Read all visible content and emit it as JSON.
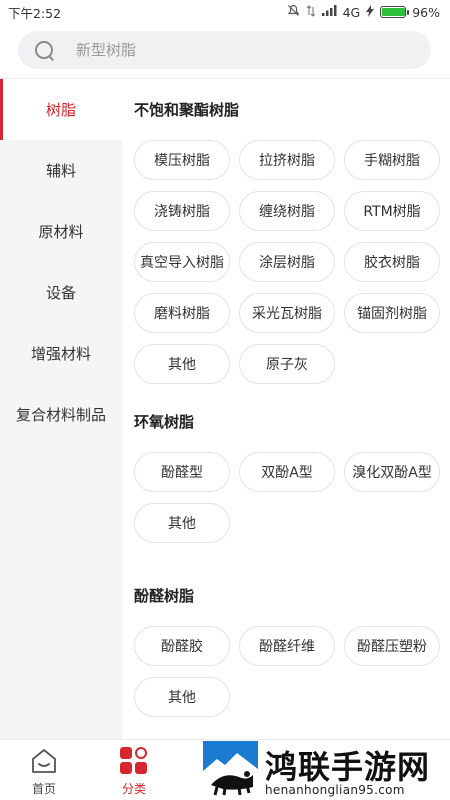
{
  "status_bar": {
    "time": "下午2:52",
    "network": "4G",
    "battery_text": "96%",
    "battery_level": 0.96,
    "battery_color": "#2bbf3a"
  },
  "search": {
    "placeholder": "新型树脂",
    "value": ""
  },
  "sidebar": {
    "items": [
      {
        "label": "树脂",
        "active": true
      },
      {
        "label": "辅料",
        "active": false
      },
      {
        "label": "原材料",
        "active": false
      },
      {
        "label": "设备",
        "active": false
      },
      {
        "label": "增强材料",
        "active": false
      },
      {
        "label": "复合材料制品",
        "active": false
      }
    ]
  },
  "sections": [
    {
      "title": "不饱和聚酯树脂",
      "tags": [
        "模压树脂",
        "拉挤树脂",
        "手糊树脂",
        "浇铸树脂",
        "缠绕树脂",
        "RTM树脂",
        "真空导入树脂",
        "涂层树脂",
        "胶衣树脂",
        "磨料树脂",
        "采光瓦树脂",
        "锚固剂树脂",
        "其他",
        "原子灰"
      ]
    },
    {
      "title": "环氧树脂",
      "tags": [
        "酚醛型",
        "双酚A型",
        "溴化双酚A型",
        "其他"
      ]
    },
    {
      "title": "酚醛树脂",
      "tags": [
        "酚醛胶",
        "酚醛纤维",
        "酚醛压塑粉",
        "其他"
      ]
    }
  ],
  "bottom_nav": {
    "items": [
      {
        "label": "首页",
        "icon": "home-icon",
        "active": false
      },
      {
        "label": "分类",
        "icon": "category-icon",
        "active": true
      }
    ]
  },
  "watermark": {
    "title": "鸿联手游网",
    "url": "henanhonglian95.com"
  },
  "colors": {
    "accent": "#d7262f",
    "sidebar_bg": "#f5f5f7",
    "search_bg": "#f1f1f3"
  }
}
